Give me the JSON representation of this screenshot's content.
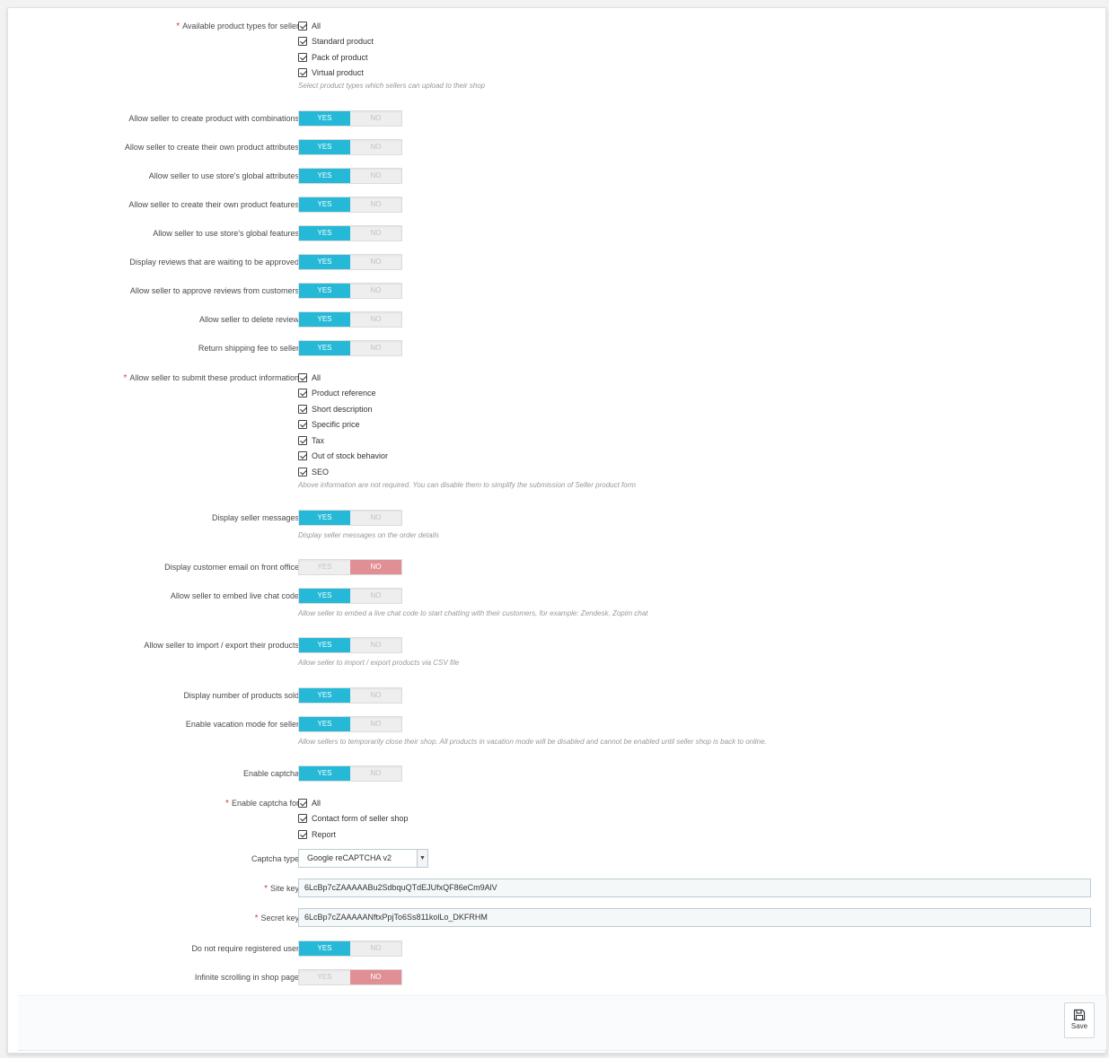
{
  "settings": {
    "product_types": {
      "label": "Available product types for seller",
      "options": [
        "All",
        "Standard product",
        "Pack of product",
        "Virtual product"
      ],
      "help": "Select product types which sellers can upload to their shop"
    },
    "allow_combinations": {
      "label": "Allow seller to create product with combinations",
      "value": "YES"
    },
    "own_attributes": {
      "label": "Allow seller to create their own product attributes",
      "value": "YES"
    },
    "global_attributes": {
      "label": "Allow seller to use store's global attributes",
      "value": "YES"
    },
    "own_features": {
      "label": "Allow seller to create their own product features",
      "value": "YES"
    },
    "global_features": {
      "label": "Allow seller to use store's global features",
      "value": "YES"
    },
    "pending_reviews": {
      "label": "Display reviews that are waiting to be approved",
      "value": "YES"
    },
    "approve_reviews": {
      "label": "Allow seller to approve reviews from customers",
      "value": "YES"
    },
    "delete_review": {
      "label": "Allow seller to delete review",
      "value": "YES"
    },
    "return_shipping": {
      "label": "Return shipping fee to seller",
      "value": "YES"
    },
    "product_info": {
      "label": "Allow seller to submit these product information",
      "options": [
        "All",
        "Product reference",
        "Short description",
        "Specific price",
        "Tax",
        "Out of stock behavior",
        "SEO"
      ],
      "help": "Above information are not required. You can disable them to simplify the submission of Seller product form"
    },
    "seller_messages": {
      "label": "Display seller messages",
      "value": "YES",
      "help": "Display seller messages on the order details"
    },
    "customer_email": {
      "label": "Display customer email on front office",
      "value": "NO"
    },
    "live_chat": {
      "label": "Allow seller to embed live chat code",
      "value": "YES",
      "help": "Allow seller to embed a live chat code to start chatting with their customers, for example: Zendesk, Zopim chat"
    },
    "import_export": {
      "label": "Allow seller to import / export their products",
      "value": "YES",
      "help": "Allow seller to import / export products via CSV file"
    },
    "products_sold": {
      "label": "Display number of products sold",
      "value": "YES"
    },
    "vacation_mode": {
      "label": "Enable vacation mode for seller",
      "value": "YES",
      "help": "Allow sellers to temporarily close their shop. All products in vacation mode will be disabled and cannot be enabled until seller shop is back to online."
    },
    "enable_captcha": {
      "label": "Enable captcha",
      "value": "YES"
    },
    "captcha_for": {
      "label": "Enable captcha for",
      "options": [
        "All",
        "Contact form of seller shop",
        "Report"
      ]
    },
    "captcha_type": {
      "label": "Captcha type",
      "value": "Google reCAPTCHA v2"
    },
    "site_key": {
      "label": "Site key",
      "value": "6LcBp7cZAAAAABu2SdbquQTdEJUfxQF86eCm9AlV"
    },
    "secret_key": {
      "label": "Secret key",
      "value": "6LcBp7cZAAAAANftxPpjTo6Ss811kolLo_DKFRHM"
    },
    "no_registration": {
      "label": "Do not require registered user",
      "value": "YES"
    },
    "infinite_scroll": {
      "label": "Infinite scrolling in shop page",
      "value": "NO"
    }
  },
  "switch_labels": {
    "yes": "YES",
    "no": "NO"
  },
  "required_mark": "*",
  "footer": {
    "save_label": "Save",
    "save_icon": "floppy-disk-icon"
  },
  "colors": {
    "accent": "#25b9d7",
    "no_active": "#e08f95",
    "required": "#e23b3b"
  }
}
